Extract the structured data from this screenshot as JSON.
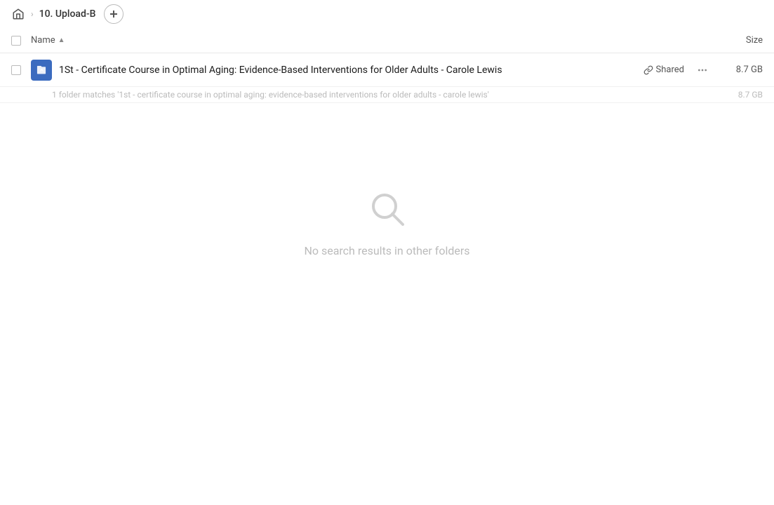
{
  "topbar": {
    "home_icon": "home",
    "breadcrumb": "10. Upload-B",
    "add_button": "+"
  },
  "columns": {
    "name_label": "Name",
    "size_label": "Size"
  },
  "file": {
    "name": "1St - Certificate Course in Optimal Aging: Evidence-Based Interventions for Older Adults - Carole Lewis",
    "shared_label": "Shared",
    "size": "8.7 GB",
    "icon": "folder-edit"
  },
  "match_info": {
    "text": "1 folder matches '1st - certificate course in optimal aging: evidence-based interventions for older adults - carole lewis'",
    "size": "8.7 GB"
  },
  "empty_state": {
    "text": "No search results in other folders"
  }
}
